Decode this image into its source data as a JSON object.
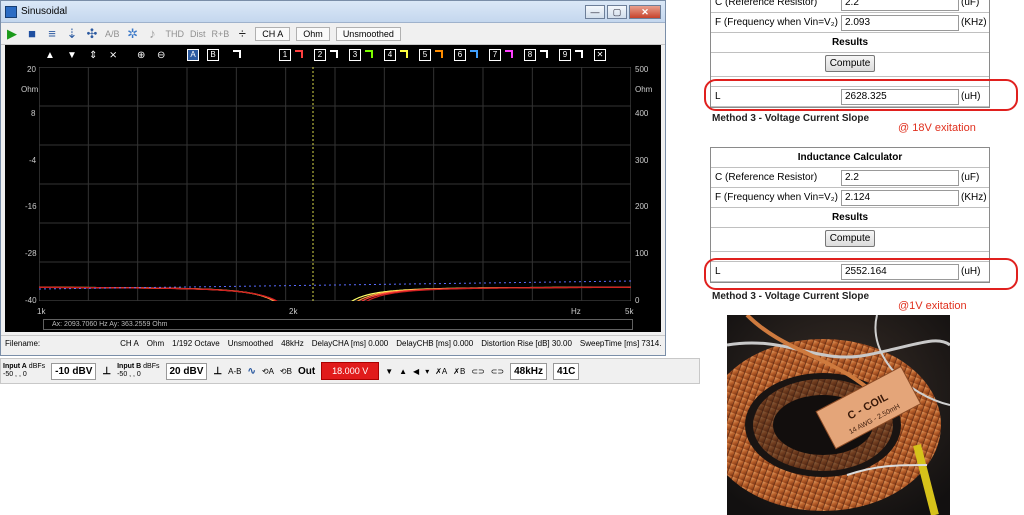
{
  "window": {
    "title": "Sinusoidal",
    "minimize": "—",
    "maximize": "▢",
    "close": "✕"
  },
  "toolbar": {
    "ab": "A/B",
    "thd": "THD",
    "dist": "Dist",
    "rplusb": "R+B",
    "channel": "CH A",
    "unit": "Ohm",
    "smoothing": "Unsmoothed"
  },
  "graph": {
    "left_axis_ticks": [
      "20",
      "Ohm",
      "8",
      "-4",
      "-16",
      "-28",
      "-40"
    ],
    "right_axis_ticks": [
      "500",
      "Ohm",
      "400",
      "300",
      "200",
      "100",
      "0"
    ],
    "x_axis_ticks": [
      "1k",
      "2k",
      "Hz",
      "5k"
    ],
    "readout": "Ax: 2093.7060 Hz   Ay: 363.2559 Ohm",
    "channel_boxes": [
      "1",
      "2",
      "3",
      "4",
      "5",
      "6",
      "7",
      "8",
      "9"
    ],
    "channel_colors": [
      "#ff4040",
      "#ffffff",
      "#7cfc00",
      "#ffff40",
      "#ff8c00",
      "#40a0ff",
      "#ff40ff",
      "#ffffff",
      "#ffffff"
    ]
  },
  "statusbar": {
    "filename": "Filename:",
    "channel": "CH A",
    "unit": "Ohm",
    "octave": "1/192 Octave",
    "smoothing": "Unsmoothed",
    "rate": "48kHz",
    "delay_a": "DelayCHA [ms] 0.000",
    "delay_b": "DelayCHB [ms] 0.000",
    "distortion": "Distortion Rise [dB] 30.00",
    "sweep": "SweepTime [ms] 7314."
  },
  "bottombar": {
    "input_a": "Input A",
    "input_a_dbfs": "dBFs",
    "input_a_scale": "-50 ,  , 0",
    "input_a_value": "-10 dBV",
    "input_b": "Input B",
    "input_b_dbfs": "dBFs",
    "input_b_scale": "-50 ,  , 0",
    "input_b_value": "20 dBV",
    "amb": "A-B",
    "out_label": "Out",
    "out_value": "18.000 V",
    "rate": "48kHz",
    "temp": "41C"
  },
  "calc1": {
    "row_c_label": "C (Reference Resistor)",
    "row_c_value": "2.2",
    "row_c_unit": "(uF)",
    "row_f_label": "F (Frequency when Vin=V₂)",
    "row_f_value": "2.093",
    "row_f_unit": "(KHz)",
    "results": "Results",
    "compute": "Compute",
    "row_l_label": "L",
    "row_l_value": "2628.325",
    "row_l_unit": "(uH)"
  },
  "method1": "Method 3 - Voltage Current Slope",
  "excite1": "@ 18V exitation",
  "calc2": {
    "title": "Inductance Calculator",
    "row_c_label": "C (Reference Resistor)",
    "row_c_value": "2.2",
    "row_c_unit": "(uF)",
    "row_f_label": "F (Frequency when Vin=V₂)",
    "row_f_value": "2.124",
    "row_f_unit": "(KHz)",
    "results": "Results",
    "compute": "Compute",
    "row_l_label": "L",
    "row_l_value": "2552.164",
    "row_l_unit": "(uH)"
  },
  "method2": "Method 3 - Voltage Current Slope",
  "excite2": "@1V exitation",
  "photo": {
    "label_line1": "C - COIL",
    "label_line2": "14 AWG - 2.50mH"
  }
}
